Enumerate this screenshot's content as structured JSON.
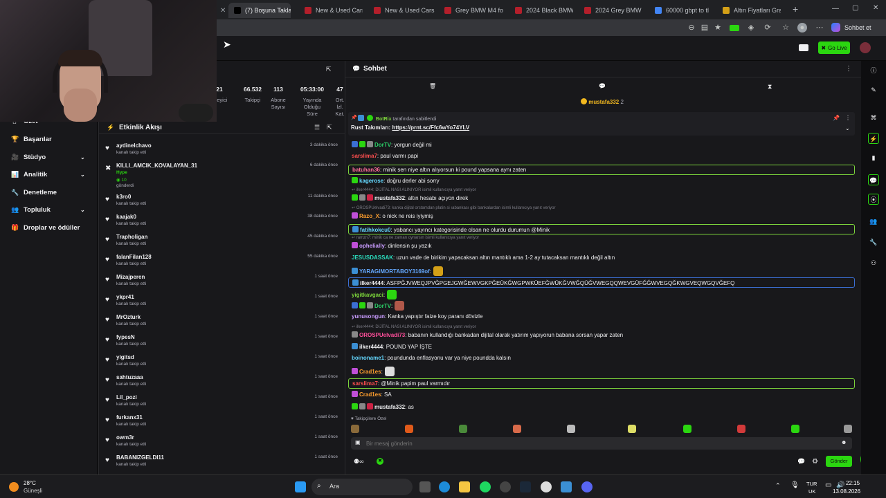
{
  "browser": {
    "tabs": [
      {
        "label": "(7) Boşuna Taklam",
        "color": "#000000"
      },
      {
        "label": "New & Used Cars",
        "color": "#b41f2b"
      },
      {
        "label": "New & Used Cars",
        "color": "#b41f2b"
      },
      {
        "label": "Grey BMW M4 fo",
        "color": "#b41f2b"
      },
      {
        "label": "2024 Black BMW",
        "color": "#b41f2b"
      },
      {
        "label": "2024 Grey BMW",
        "color": "#b41f2b"
      },
      {
        "label": "60000 gbpt to tl",
        "color": "#4285f4"
      },
      {
        "label": "Altın Fiyatları Gra",
        "color": "#d4a017"
      }
    ],
    "new_tab": "+",
    "profile_label": "Sohbet et"
  },
  "topnav": {
    "go_live": "Go Live"
  },
  "sidebar": {
    "items": [
      {
        "label": "Özet",
        "icon": "home-icon",
        "glyph": "⌂",
        "chev": false
      },
      {
        "label": "Başarılar",
        "icon": "trophy-icon",
        "glyph": "🏆",
        "chev": false
      },
      {
        "label": "Stüdyo",
        "icon": "studio-icon",
        "glyph": "🎥",
        "chev": true
      },
      {
        "label": "Analitik",
        "icon": "chart-icon",
        "glyph": "📊",
        "chev": true
      },
      {
        "label": "Denetleme",
        "icon": "wrench-icon",
        "glyph": "🔧",
        "chev": false
      },
      {
        "label": "Topluluk",
        "icon": "people-icon",
        "glyph": "👥",
        "chev": true
      },
      {
        "label": "Droplar ve ödüller",
        "icon": "gift-icon",
        "glyph": "🎁",
        "chev": false
      }
    ]
  },
  "stats": [
    {
      "value": "21",
      "label": "İzleyici"
    },
    {
      "value": "66.532",
      "label": "Takipçi"
    },
    {
      "value": "113",
      "label": "Abone Sayısı"
    },
    {
      "value": "05:33:00",
      "label": "Yayında Olduğu Süre"
    },
    {
      "value": "47",
      "label": "Ort. İzl. Kat."
    }
  ],
  "feed": {
    "title": "Etkinlik Akışı",
    "items": [
      {
        "name": "aydinelchavo",
        "action": "kanalı takip etti",
        "time": "3 dakika önce"
      },
      {
        "name": "KILLI_AMCIK_KOVALAYAN_31",
        "action": "Hype",
        "extra": "10",
        "extra2": "gönderdi",
        "time": "6 dakika önce"
      },
      {
        "name": "k3ro0",
        "action": "kanalı takip etti",
        "time": "11 dakika önce"
      },
      {
        "name": "kaajak0",
        "action": "kanalı takip etti",
        "time": "38 dakika önce"
      },
      {
        "name": "Trapholigan",
        "action": "kanalı takip etti",
        "time": "45 dakika önce"
      },
      {
        "name": "falanFilan128",
        "action": "kanalı takip etti",
        "time": "55 dakika önce"
      },
      {
        "name": "Mizajperen",
        "action": "kanalı takip etti",
        "time": "1 saat önce"
      },
      {
        "name": "ykpr41",
        "action": "kanalı takip etti",
        "time": "1 saat önce"
      },
      {
        "name": "MrOzturk",
        "action": "kanalı takip etti",
        "time": "1 saat önce"
      },
      {
        "name": "fypesN",
        "action": "kanalı takip etti",
        "time": "1 saat önce"
      },
      {
        "name": "yigitsd",
        "action": "kanalı takip etti",
        "time": "1 saat önce"
      },
      {
        "name": "sahtuzaaa",
        "action": "kanalı takip etti",
        "time": "1 saat önce"
      },
      {
        "name": "Lil_pozi",
        "action": "kanalı takip etti",
        "time": "1 saat önce"
      },
      {
        "name": "furkanx31",
        "action": "kanalı takip etti",
        "time": "1 saat önce"
      },
      {
        "name": "owm3r",
        "action": "kanalı takip etti",
        "time": "1 saat önce"
      },
      {
        "name": "BABANIZGELDI11",
        "action": "kanalı takip etti",
        "time": "1 saat önce"
      }
    ]
  },
  "chat": {
    "title": "Sohbet",
    "top_user": "mustafa332",
    "top_count": "2",
    "pinned_by": "BotRix",
    "pinned_suffix": "tarafından sabitlendi",
    "pinned_label": "Rust Takımları:",
    "pinned_link": "https://prnt.sc/Ffc6wYo74YLV",
    "messages": [
      {
        "user": "DorTV",
        "color": "#2bd66b",
        "text": ": yorgun değil mi"
      },
      {
        "user": "sarslima7",
        "color": "#ff4f4f",
        "text": ": paul varmı papi"
      },
      {
        "user": "batuhan36",
        "color": "#ff6f9a",
        "text": ": minik sen niye altın alıyorsun ki pound yapsana aynı zaten"
      },
      {
        "user": "kagerose",
        "color": "#64d8ff",
        "text": ": doğru derler abi sorry"
      },
      {
        "reply": "ilker4444: DİJİTAL NASI ALINIYOR isimli kullanıcıya yanıt veriyor",
        "user": "mustafa332",
        "color": "#efeff1",
        "text": ": altın hesabı açıyon direk"
      },
      {
        "reply": "OROSPUelvadi73: kanka dijital orstamdan platin si ıabankası gibi bankalardan isimli kullanıcıya yanıt veriyor",
        "user": "Razo_X",
        "color": "#ff9f2e",
        "text": ": o nick ne reis iyiymiş"
      },
      {
        "user": "fatihkokcu0",
        "color": "#64d8ff",
        "text": ": yabancı yayıncı kategorisinde olsan ne olurdu durumun @Minik"
      },
      {
        "reply": "ramzn7: minik ca ne zaman oynarsın isimli kullanıcıya yanıt veriyor",
        "user": "ophelially",
        "color": "#c99cff",
        "text": ": dinlensin şu yazık"
      },
      {
        "user": "JESUSDASSAK",
        "color": "#2be0c0",
        "text": ": uzun vade de birikim yapacaksan altın mantıklı ama 1-2 ay tutacaksan mantıklı değil altın"
      },
      {
        "user": "YARAGIMORTABOY3169of",
        "color": "#64a8ff",
        "text": ":"
      },
      {
        "user": "ilker4444",
        "color": "#efeff1",
        "text": ": ASFPĞJVWEQJPVĞPGEJGWĞEWVGKPĞEÜKĞWGPWKÜEFĞWÜKĞVWĞQÜĞVWEGQQWEVGÜFĞĞWVEGQĞKWGVEQWGQVĞEFQ"
      },
      {
        "user": "yigitkavgaci",
        "color": "#7cd43b",
        "text": ":"
      },
      {
        "user": "DorTV",
        "color": "#2bd66b",
        "text": ":"
      },
      {
        "user": "yunusongun",
        "color": "#c99cff",
        "text": ": Kanka yapıştır faize koy paranı dövizle"
      },
      {
        "reply": "ilker4444: DİJİTAL NASI ALINIYOR isimli kullanıcıya yanıt veriyor",
        "user": "OROSPUelvadi73",
        "color": "#ff4f9a",
        "text": ": babanın kullandığı bankadan dijital olarak yatırım yapıyorun babana sorsan yapar zaten"
      },
      {
        "user": "ilker4444",
        "color": "#efeff1",
        "text": ": POUND YAP İŞTE"
      },
      {
        "user": "boinoname1",
        "color": "#64d8ff",
        "text": ": poundunda enflasyonu var ya niye poundda kalsın"
      },
      {
        "user": "Crad1es",
        "color": "#ff9f2e",
        "text": ":"
      },
      {
        "user": "sarslima7",
        "color": "#ff4f4f",
        "text": ": @Minik papim paul varmıdır"
      },
      {
        "user": "Crad1es",
        "color": "#ff9f2e",
        "text": ": SA"
      },
      {
        "user": "mustafa332",
        "color": "#efeff1",
        "text": ": as"
      }
    ],
    "followers_only": "Takipçilere Özel",
    "input_placeholder": "Bir mesaj gönderin",
    "send": "Gönder"
  },
  "taskbar": {
    "temp": "28°C",
    "weather": "Güneşli",
    "search": "Ara",
    "lang1": "TUR",
    "lang2": "UK",
    "time": "22:15",
    "date": "13.08.2026"
  },
  "colors": {
    "twitch_green": "#2bd610",
    "accent_purple": "#9147ff"
  }
}
